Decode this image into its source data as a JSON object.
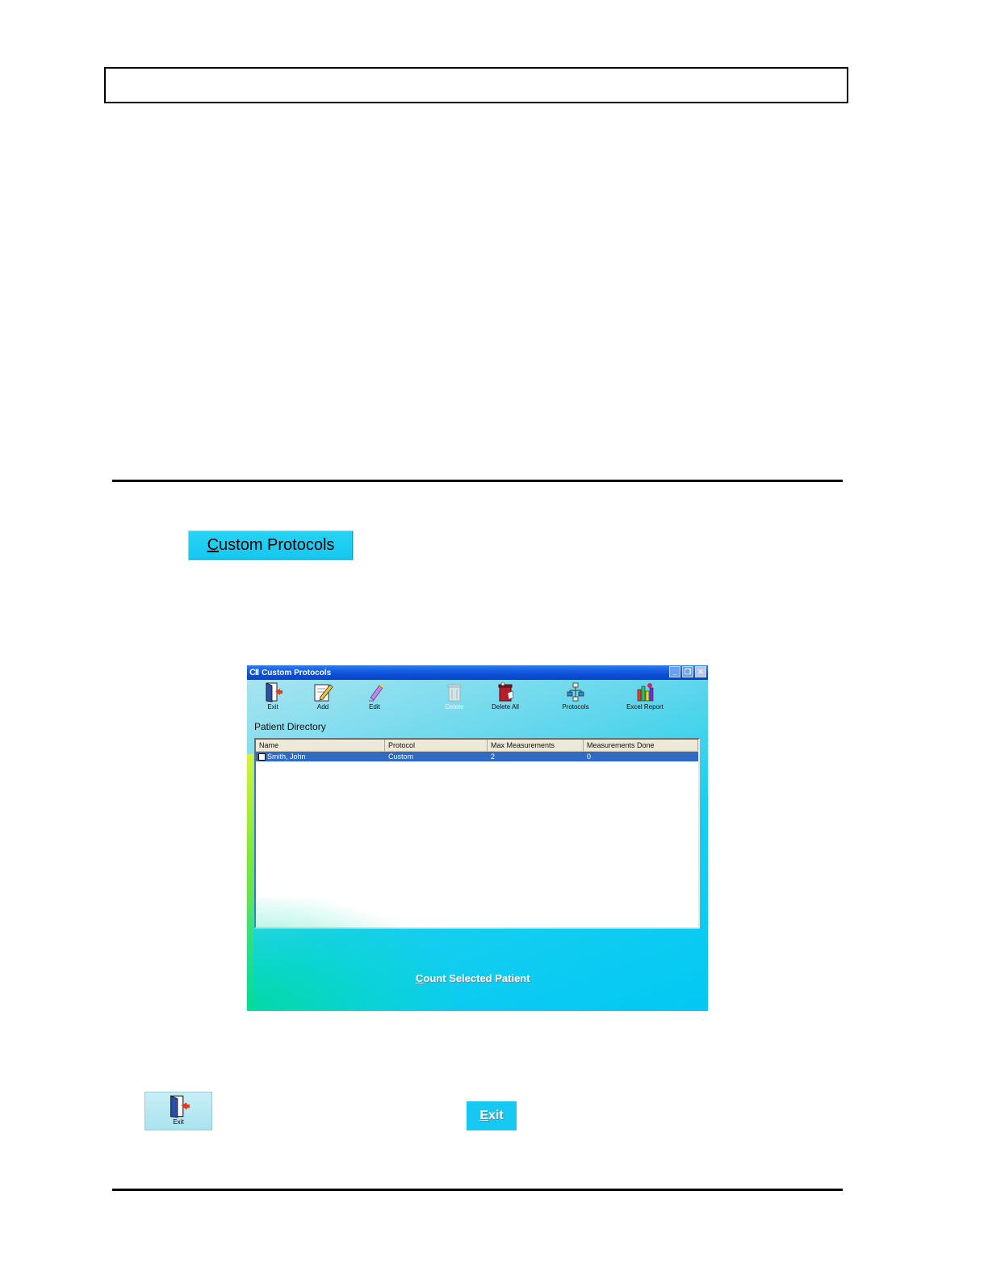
{
  "header_box": {
    "text": ""
  },
  "custom_protocols_button": {
    "underline_letter": "C",
    "rest": "ustom Protocols"
  },
  "window": {
    "title_logo": "CII",
    "title": "Custom Protocols",
    "controls": {
      "minimize": "_",
      "restore": "❐",
      "close": "✕"
    },
    "toolbar": [
      {
        "label": "Exit",
        "icon": "exit-door-icon",
        "enabled": true
      },
      {
        "label": "Add",
        "icon": "add-pencil-icon",
        "enabled": true
      },
      {
        "label": "Edit",
        "icon": "edit-eraser-icon",
        "enabled": true
      },
      {
        "label": "Delete",
        "icon": "delete-trash-icon",
        "enabled": false
      },
      {
        "label": "Delete All",
        "icon": "delete-all-trash-icon",
        "enabled": true
      },
      {
        "label": "Protocols",
        "icon": "protocols-tree-icon",
        "enabled": true
      },
      {
        "label": "Excel Report",
        "icon": "excel-report-icon",
        "enabled": true
      }
    ],
    "section_label": "Patient Directory",
    "columns": [
      "Name",
      "Protocol",
      "Max Measurements",
      "Measurements Done"
    ],
    "rows": [
      {
        "name": "Smith, John",
        "protocol": "Custom",
        "max_measurements": "2",
        "measurements_done": "0",
        "selected": true
      }
    ],
    "count_button": {
      "underline_letter": "C",
      "rest": "ount Selected Patient"
    }
  },
  "bottom": {
    "exit_icon_label": "Exit",
    "exit_button": {
      "underline_letter": "E",
      "rest": "xit"
    }
  },
  "colors": {
    "accent_cyan": "#17c9f1",
    "titlebar_blue": "#0c4fd8",
    "selection_blue": "#316ac5"
  }
}
